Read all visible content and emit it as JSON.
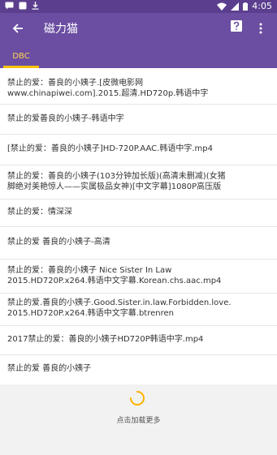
{
  "status_bar": {
    "time": "4:05",
    "icons_left": [
      "message-icon",
      "square-icon",
      "download-icon"
    ],
    "icons_right": [
      "wifi-icon",
      "signal-icon",
      "battery-icon"
    ]
  },
  "app_bar": {
    "title": "磁力猫",
    "back_icon": "arrow-left-icon",
    "help_icon": "question-icon",
    "more_icon": "more-vert-icon",
    "bg_color": "#6b4ea2"
  },
  "tabs": [
    {
      "label": "DBC",
      "active": true,
      "color": "#ffd54f"
    }
  ],
  "results": [
    {
      "title": "禁止的爱：善良的小姨子.[皮微电影网\nwww.chinapiwei.com].2015.超清.HD720p.韩语中字"
    },
    {
      "title": "禁止的爱善良的小姨子-韩语中字"
    },
    {
      "title": "[禁止的爱：善良的小姨子]HD-720P.AAC.韩语中字.mp4"
    },
    {
      "title": "禁止的爱：善良的小姨子(103分钟加长版)(高清未删减)(女猪\n脚绝对美艳惊人——实属极品女神)[中文字幕]1080P高压版"
    },
    {
      "title": "禁止的爱：情深深"
    },
    {
      "title": "禁止的爱 善良的小姨子-高清"
    },
    {
      "title": "禁止的爱：善良的小姨子 Nice Sister In Law\n2015.HD720P.x264.韩语中文字幕.Korean.chs.aac.mp4"
    },
    {
      "title": "禁止的爱.善良的小姨子.Good.Sister.in.law.Forbidden.love.\n2015.HD720P.x264.韩语中文字幕.btrenren"
    },
    {
      "title": "2017禁止的爱：善良的小姨子HD720P韩语中字.mp4"
    },
    {
      "title": "禁止的爱 善良的小姨子"
    }
  ],
  "footer": {
    "load_more": "点击加载更多",
    "spinner_color": "#ffb300"
  }
}
